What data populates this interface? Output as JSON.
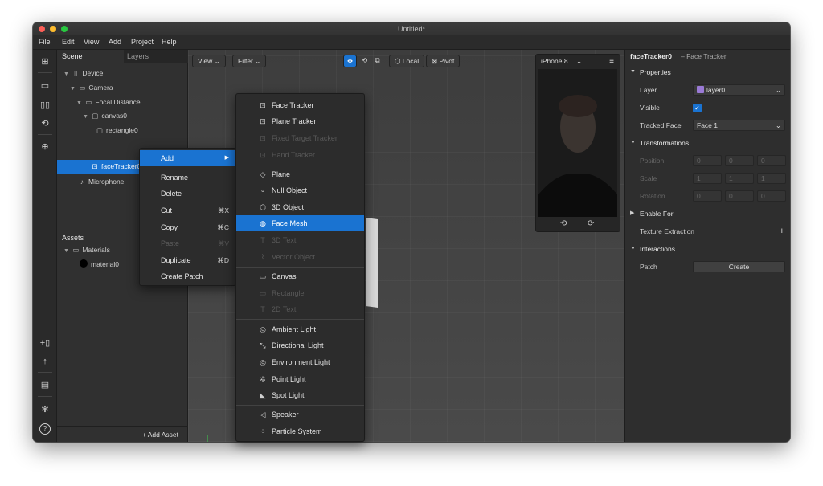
{
  "window": {
    "title": "Untitled*"
  },
  "menubar": [
    "File",
    "Edit",
    "View",
    "Add",
    "Project",
    "Help"
  ],
  "colors": {
    "accent": "#1a73d1",
    "close": "#fe5f57",
    "minimize": "#febc2e",
    "zoom": "#28c840",
    "layer_swatch": "#9a7ad6",
    "checkbox": "#1a73d1"
  },
  "toolstrip": {
    "top_icons": [
      "layout-icon",
      "camera-icon",
      "split-icon",
      "refresh-icon",
      "zoom-icon"
    ],
    "bottom_icons": [
      "add-device-icon",
      "upload-icon",
      "folder-icon",
      "bug-icon",
      "help-icon"
    ]
  },
  "scene_panel": {
    "tabs": [
      "Scene",
      "Layers"
    ],
    "tree": [
      {
        "label": "Device",
        "icon": "device-icon",
        "caret": "▼"
      },
      {
        "label": "Camera",
        "icon": "camera-icon",
        "caret": "▼"
      },
      {
        "label": "Focal Distance",
        "icon": "focal-icon",
        "caret": "▼"
      },
      {
        "label": "canvas0",
        "icon": "canvas-icon",
        "caret": "▼"
      },
      {
        "label": "rectangle0",
        "icon": "rectangle-icon",
        "caret": ""
      },
      {
        "label": "faceTracker0",
        "icon": "face-tracker-icon",
        "caret": ""
      },
      {
        "label": "Microphone",
        "icon": "microphone-icon",
        "caret": ""
      }
    ],
    "add_symbol": "+",
    "assets_title": "Assets",
    "assets_tree": [
      {
        "label": "Materials",
        "icon": "folder-icon",
        "caret": "▼"
      },
      {
        "label": "material0",
        "icon": "material-icon",
        "caret": ""
      }
    ],
    "add_asset_label": "+ Add Asset"
  },
  "viewport": {
    "view_label": "View",
    "filter_label": "Filter",
    "local_label": "Local",
    "pivot_label": "Pivot",
    "device_label": "iPhone 8"
  },
  "context_menu": {
    "items": [
      {
        "label": "Add",
        "shortcut": "▶",
        "state": "active"
      },
      {
        "label": "Rename",
        "shortcut": "",
        "state": "normal"
      },
      {
        "label": "Delete",
        "shortcut": "",
        "state": "normal"
      },
      {
        "label": "Cut",
        "shortcut": "⌘X",
        "state": "normal"
      },
      {
        "label": "Copy",
        "shortcut": "⌘C",
        "state": "normal"
      },
      {
        "label": "Paste",
        "shortcut": "⌘V",
        "state": "disabled"
      },
      {
        "label": "Duplicate",
        "shortcut": "⌘D",
        "state": "normal"
      },
      {
        "label": "Create Patch",
        "shortcut": "",
        "state": "normal"
      }
    ]
  },
  "add_submenu": {
    "items": [
      {
        "label": "Face Tracker",
        "icon": "face-tracker-icon",
        "glyph": "⊡",
        "state": "normal"
      },
      {
        "label": "Plane Tracker",
        "icon": "plane-tracker-icon",
        "glyph": "⊡",
        "state": "normal"
      },
      {
        "label": "Fixed Target Tracker",
        "icon": "target-tracker-icon",
        "glyph": "⊡",
        "state": "disabled"
      },
      {
        "label": "Hand Tracker",
        "icon": "hand-tracker-icon",
        "glyph": "⊡",
        "state": "disabled"
      },
      {
        "label": "Plane",
        "icon": "plane-icon",
        "glyph": "◇",
        "state": "normal"
      },
      {
        "label": "Null Object",
        "icon": "null-object-icon",
        "glyph": "∘",
        "state": "normal"
      },
      {
        "label": "3D Object",
        "icon": "cube-icon",
        "glyph": "⬡",
        "state": "normal"
      },
      {
        "label": "Face Mesh",
        "icon": "face-mesh-icon",
        "glyph": "◍",
        "state": "active"
      },
      {
        "label": "3D Text",
        "icon": "text-3d-icon",
        "glyph": "T",
        "state": "disabled"
      },
      {
        "label": "Vector Object",
        "icon": "vector-icon",
        "glyph": "⌇",
        "state": "disabled"
      },
      {
        "label": "Canvas",
        "icon": "canvas-icon",
        "glyph": "▭",
        "state": "normal"
      },
      {
        "label": "Rectangle",
        "icon": "rectangle-icon",
        "glyph": "▭",
        "state": "disabled"
      },
      {
        "label": "2D Text",
        "icon": "text-2d-icon",
        "glyph": "T",
        "state": "disabled"
      },
      {
        "label": "Ambient Light",
        "icon": "ambient-light-icon",
        "glyph": "◎",
        "state": "normal"
      },
      {
        "label": "Directional Light",
        "icon": "directional-light-icon",
        "glyph": "⤡",
        "state": "normal"
      },
      {
        "label": "Environment Light",
        "icon": "environment-light-icon",
        "glyph": "◎",
        "state": "normal"
      },
      {
        "label": "Point Light",
        "icon": "point-light-icon",
        "glyph": "✲",
        "state": "normal"
      },
      {
        "label": "Spot Light",
        "icon": "spot-light-icon",
        "glyph": "◣",
        "state": "normal"
      },
      {
        "label": "Speaker",
        "icon": "speaker-icon",
        "glyph": "◁",
        "state": "normal"
      },
      {
        "label": "Particle System",
        "icon": "particle-icon",
        "glyph": "⁘",
        "state": "normal"
      }
    ]
  },
  "properties": {
    "object_name": "faceTracker0",
    "object_type": "– Face Tracker",
    "section_properties": "Properties",
    "layer_label": "Layer",
    "layer_value": "layer0",
    "visible_label": "Visible",
    "tracked_face_label": "Tracked Face",
    "tracked_face_value": "Face 1",
    "section_transformations": "Transformations",
    "position_label": "Position",
    "position_values": [
      "0",
      "0",
      "0"
    ],
    "scale_label": "Scale",
    "scale_values": [
      "1",
      "1",
      "1"
    ],
    "rotation_label": "Rotation",
    "rotation_values": [
      "0",
      "0",
      "0"
    ],
    "enable_for_label": "Enable For",
    "texture_extraction_label": "Texture Extraction",
    "interactions_label": "Interactions",
    "patch_label": "Patch",
    "create_label": "Create"
  }
}
